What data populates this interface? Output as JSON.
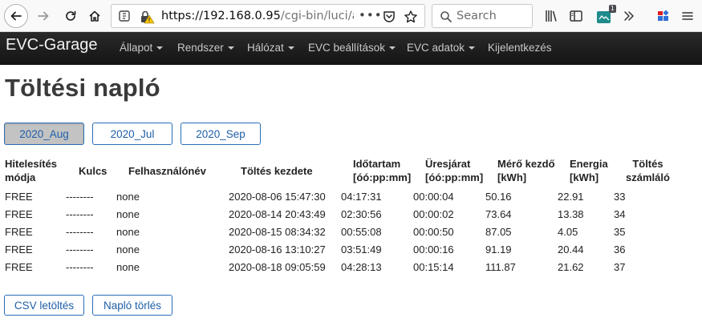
{
  "browser": {
    "url_host": "https://192.168.0.95",
    "url_path": "/cgi-bin/luci/a",
    "url_more": "•••",
    "search_placeholder": "Search",
    "extension_badge": "1"
  },
  "navbar": {
    "brand": "EVC-Garage",
    "items": [
      {
        "label": "Állapot",
        "dropdown": true
      },
      {
        "label": "Rendszer",
        "dropdown": true
      },
      {
        "label": "Hálózat",
        "dropdown": true
      },
      {
        "label": "EVC beállítások",
        "dropdown": true
      },
      {
        "label": "EVC adatok",
        "dropdown": true
      },
      {
        "label": "Kijelentkezés",
        "dropdown": false
      }
    ]
  },
  "page": {
    "title": "Töltési napló",
    "tabs": [
      {
        "label": "2020_Aug",
        "active": true
      },
      {
        "label": "2020_Jul",
        "active": false
      },
      {
        "label": "2020_Sep",
        "active": false
      }
    ]
  },
  "table": {
    "headers": [
      [
        "Hitelesítés",
        "módja"
      ],
      [
        "Kulcs"
      ],
      [
        "Felhasználónév"
      ],
      [
        "Töltés kezdete"
      ],
      [
        "Időtartam",
        "[óó:pp:mm]"
      ],
      [
        "Üresjárat",
        "[óó:pp:mm]"
      ],
      [
        "Mérő kezdő",
        "[kWh]"
      ],
      [
        "Energia",
        "[kWh]"
      ],
      [
        "Töltés",
        "számláló"
      ]
    ],
    "rows": [
      [
        "FREE",
        "--------",
        "none",
        "2020-08-06 15:47:30",
        "04:17:31",
        "00:00:04",
        "50.16",
        "22.91",
        "33"
      ],
      [
        "FREE",
        "--------",
        "none",
        "2020-08-14 20:43:49",
        "02:30:56",
        "00:00:02",
        "73.64",
        "13.38",
        "34"
      ],
      [
        "FREE",
        "--------",
        "none",
        "2020-08-15 08:34:32",
        "00:55:08",
        "00:00:50",
        "87.05",
        "4.05",
        "35"
      ],
      [
        "FREE",
        "--------",
        "none",
        "2020-08-16 13:10:27",
        "03:51:49",
        "00:00:16",
        "91.19",
        "20.44",
        "36"
      ],
      [
        "FREE",
        "--------",
        "none",
        "2020-08-18 09:05:59",
        "04:28:13",
        "00:15:14",
        "111.87",
        "21.62",
        "37"
      ]
    ]
  },
  "actions": {
    "csv_label": "CSV letöltés",
    "clear_label": "Napló törlés"
  },
  "colors": {
    "navbar_bg": "#1a1a1a",
    "button_border": "#2b6cb5",
    "active_tab_bg": "#c3c3c3"
  }
}
